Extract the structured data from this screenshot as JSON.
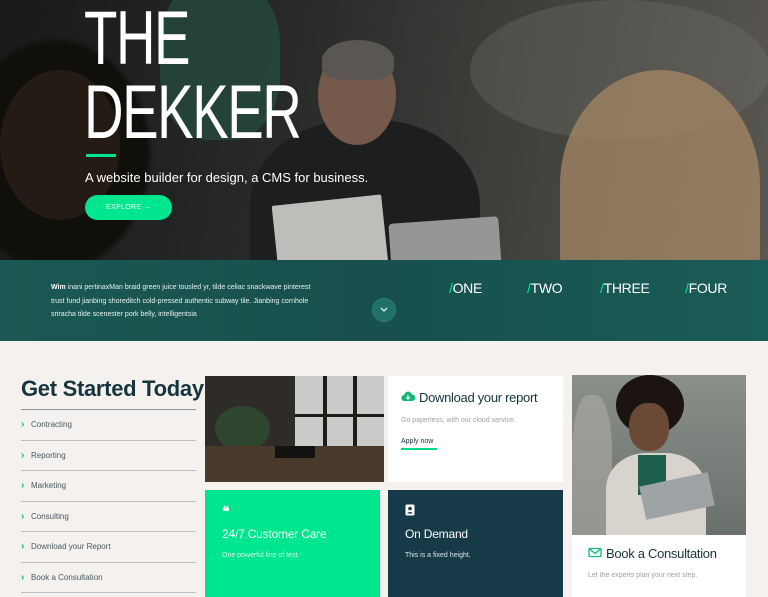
{
  "hero": {
    "title_line1": "THE",
    "title_line2": "DEKKER",
    "subtitle": "A website builder for design, a CMS for business.",
    "explore_label": "EXPLORE →"
  },
  "band": {
    "text_bold": "Wim",
    "text_rest": " inani pertinaxMan braid green juice tousled yr, tilde celiac snackwave pinterest trust fund jianbing shoreditch cold-pressed authentic subway tile. Jianbing cornhole sriracha tilde scenester pork belly, intelligentsia",
    "tabs": [
      {
        "slash": "/",
        "label": "ONE"
      },
      {
        "slash": "/",
        "label": "TWO"
      },
      {
        "slash": "/",
        "label": "THREE"
      },
      {
        "slash": "/",
        "label": "FOUR"
      }
    ]
  },
  "sidebar": {
    "title": "Get Started Today",
    "items": [
      {
        "label": "Contracting"
      },
      {
        "label": "Reporting"
      },
      {
        "label": "Marketing"
      },
      {
        "label": "Consulting"
      },
      {
        "label": "Download your Report"
      },
      {
        "label": "Book a Consultation"
      }
    ]
  },
  "report_card": {
    "title": "Download your report",
    "desc": "Go paperless, with our cloud service.",
    "link": "Apply now"
  },
  "consult_card": {
    "title": "Book a Consultation",
    "desc": "Let the experts plan your next step."
  },
  "care_card": {
    "icon": "❝",
    "title": "24/7 Customer Care",
    "desc": "One powerful line of text."
  },
  "demand_card": {
    "title": "On Demand",
    "desc": "This is a fixed height."
  },
  "colors": {
    "accent": "#00e68e",
    "teal_band": "#17504c",
    "navy": "#173a49",
    "background": "#f4f1ef"
  }
}
